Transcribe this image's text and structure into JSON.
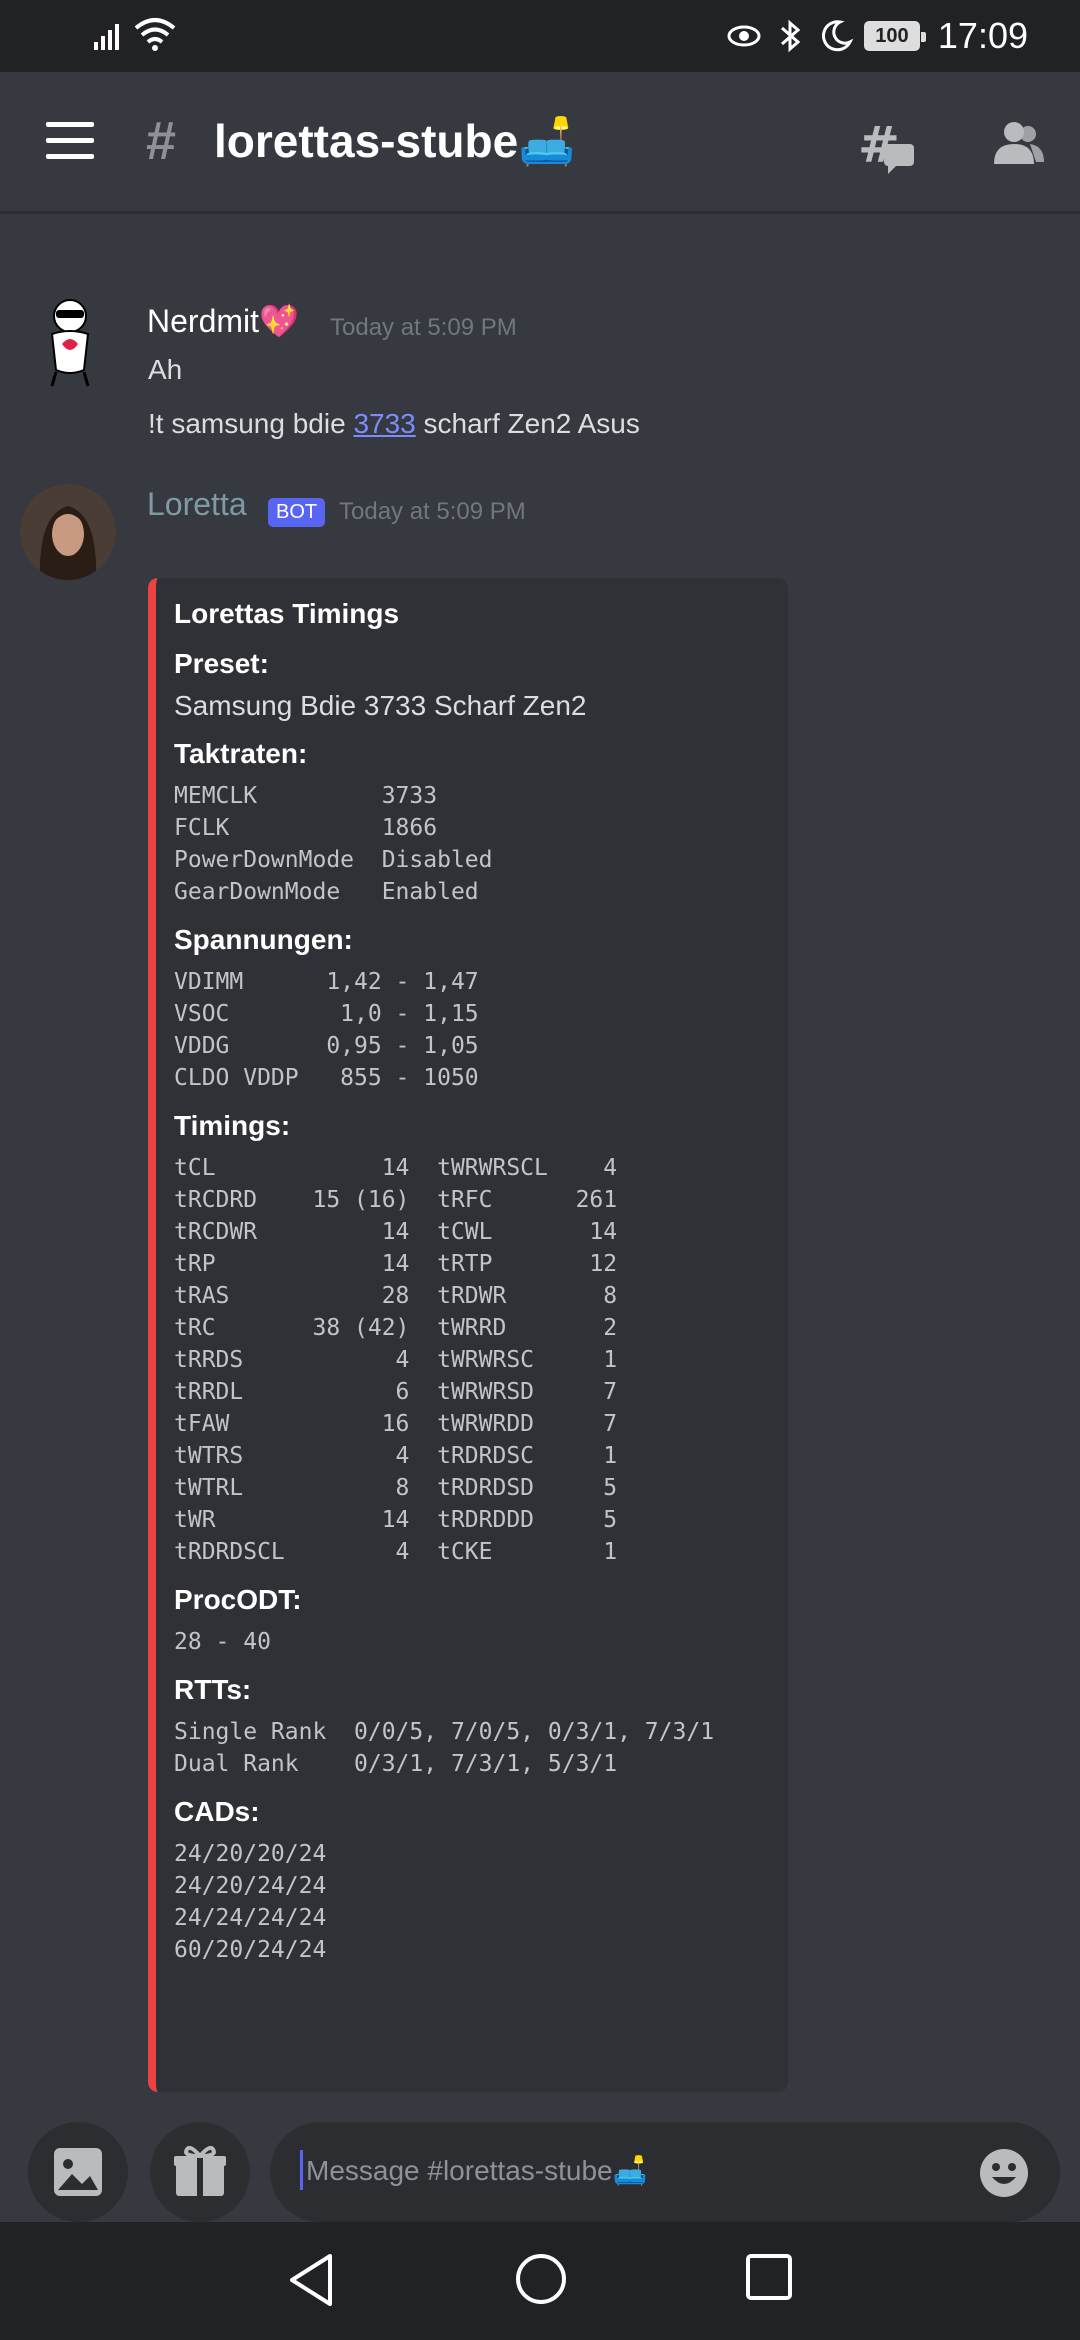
{
  "status_bar": {
    "time": "17:09",
    "battery": "100"
  },
  "header": {
    "channel_name": "lorettas-stube🛋️"
  },
  "messages": [
    {
      "author": "Nerdmit💖",
      "timestamp": "Today at 5:09 PM",
      "lines": [
        "Ah",
        "!t samsung bdie 3733 scharf Zen2 Asus"
      ],
      "link_text": "3733",
      "line2_before": "!t samsung bdie ",
      "line2_after": " scharf Zen2 Asus"
    },
    {
      "author": "Loretta",
      "badge": "BOT",
      "timestamp": "Today at 5:09 PM"
    }
  ],
  "embed": {
    "color": "#ed4245",
    "title": "Lorettas Timings",
    "preset_label": "Preset:",
    "preset_value": "Samsung Bdie 3733 Scharf Zen2",
    "taktraten_label": "Taktraten:",
    "taktraten": "MEMCLK         3733\nFCLK           1866\nPowerDownMode  Disabled\nGearDownMode   Enabled",
    "spannungen_label": "Spannungen:",
    "spannungen": "VDIMM      1,42 - 1,47\nVSOC        1,0 - 1,15\nVDDG       0,95 - 1,05\nCLDO VDDP   855 - 1050",
    "timings_label": "Timings:",
    "timings": "tCL            14  tWRWRSCL    4\ntRCDRD    15 (16)  tRFC      261\ntRCDWR         14  tCWL       14\ntRP            14  tRTP       12\ntRAS           28  tRDWR       8\ntRC       38 (42)  tWRRD       2\ntRRDS           4  tWRWRSC     1\ntRRDL           6  tWRWRSD     7\ntFAW           16  tWRWRDD     7\ntWTRS           4  tRDRDSC     1\ntWTRL           8  tRDRDSD     5\ntWR            14  tRDRDDD     5\ntRDRDSCL        4  tCKE        1",
    "procodt_label": "ProcODT:",
    "procodt": "28 - 40",
    "rtts_label": "RTTs:",
    "rtts": "Single Rank  0/0/5, 7/0/5, 0/3/1, 7/3/1\nDual Rank    0/3/1, 7/3/1, 5/3/1",
    "cads_label": "CADs:",
    "cads": "24/20/20/24\n24/20/24/24\n24/24/24/24\n60/20/24/24"
  },
  "composer": {
    "placeholder": "Message #lorettas-stube🛋️"
  }
}
